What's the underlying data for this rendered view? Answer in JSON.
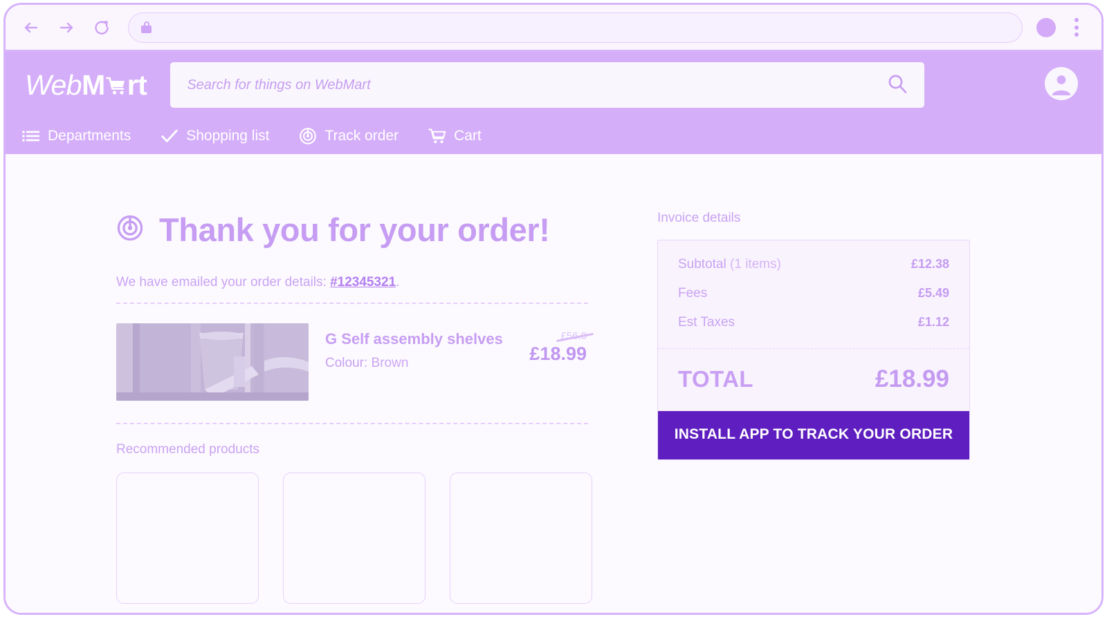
{
  "browser": {
    "back_label": "back",
    "forward_label": "forward",
    "reload_label": "reload",
    "url_value": "",
    "url_placeholder": "",
    "lock_label": "secure",
    "profile_label": "profile",
    "menu_label": "browser menu"
  },
  "header": {
    "logo": {
      "part1": "Web",
      "part2": "M",
      "part3": "rt",
      "cart_icon": "shopping-cart-icon"
    },
    "search": {
      "placeholder": "Search for things on WebMart",
      "value": "",
      "icon": "search-icon"
    },
    "account": {
      "label": "Account",
      "icon": "account-circle-icon"
    },
    "nav": [
      {
        "label": "Departments",
        "icon": "list-menu-icon"
      },
      {
        "label": "Shopping list",
        "icon": "check-icon"
      },
      {
        "label": "Track order",
        "icon": "radar-target-icon"
      },
      {
        "label": "Cart",
        "icon": "shopping-cart-icon"
      }
    ]
  },
  "main": {
    "thanks": {
      "icon": "radar-target-icon",
      "title": "Thank you for your order!"
    },
    "emailed": {
      "prefix": "We have emailed your order details:",
      "order_number": "#12345321",
      "suffix": "."
    },
    "order_item": {
      "image_alt": "Self assembly shelves product photo",
      "name": "G Self assembly shelves",
      "colour_label": "Colour:",
      "colour_value": "Brown",
      "old_price": "£56.0",
      "price": "£18.99"
    },
    "recommended": {
      "title": "Recommended products",
      "cards": [
        {
          "label": "recommended product 1"
        },
        {
          "label": "recommended product 2"
        },
        {
          "label": "recommended product 3"
        }
      ]
    }
  },
  "invoice": {
    "title": "Invoice details",
    "rows": [
      {
        "label": "Subtotal",
        "label_muted": "(1 items)",
        "value": "£12.38"
      },
      {
        "label": "Fees",
        "label_muted": "",
        "value": "£5.49"
      },
      {
        "label": "Est Taxes",
        "label_muted": "",
        "value": "£1.12"
      }
    ],
    "total_label": "TOTAL",
    "total_value": "£18.99",
    "install_button": "INSTALL APP TO TRACK YOUR ORDER"
  },
  "colors": {
    "header_purple": "#d5aefa",
    "brand_deep_purple": "#5f1fc0",
    "text_lilac": "#c9a3f2",
    "page_bg": "#fcfaff",
    "frame_border": "#d7b3fb"
  }
}
